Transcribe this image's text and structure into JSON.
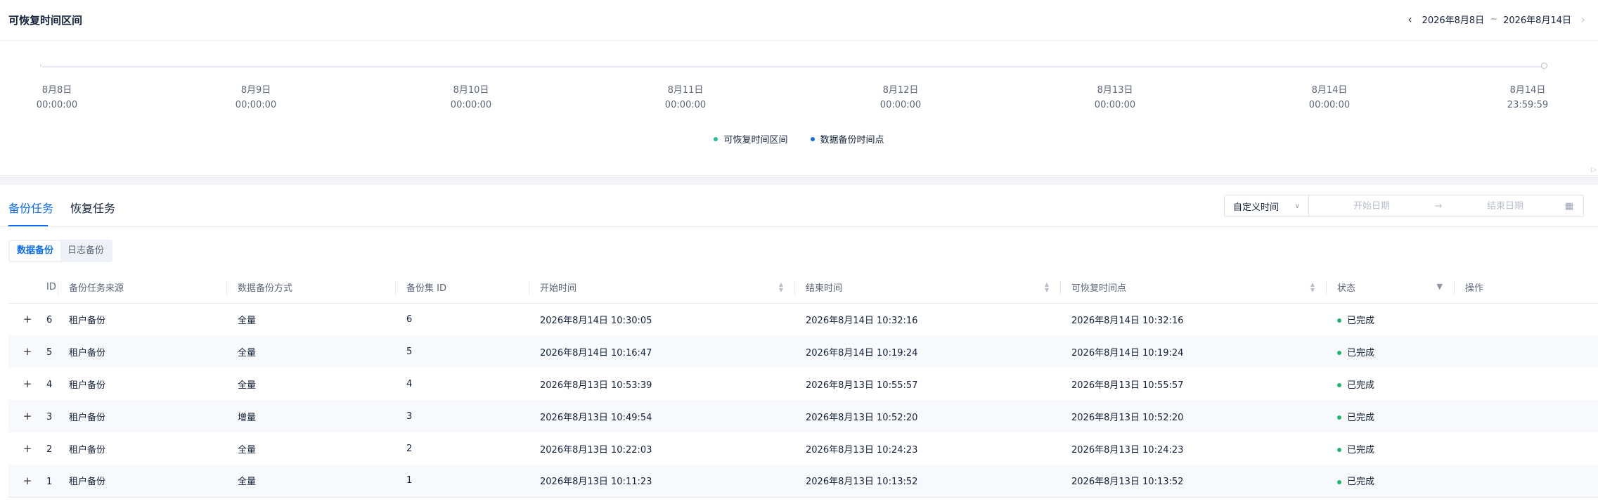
{
  "panel": {
    "title": "可恢复时间区间",
    "range_start": "2026年8月8日",
    "range_sep": "~",
    "range_end": "2026年8月14日"
  },
  "timeline": {
    "ticks": [
      {
        "date": "8月8日",
        "time": "00:00:00"
      },
      {
        "date": "8月9日",
        "time": "00:00:00"
      },
      {
        "date": "8月10日",
        "time": "00:00:00"
      },
      {
        "date": "8月11日",
        "time": "00:00:00"
      },
      {
        "date": "8月12日",
        "time": "00:00:00"
      },
      {
        "date": "8月13日",
        "time": "00:00:00"
      },
      {
        "date": "8月14日",
        "time": "00:00:00"
      },
      {
        "date": "8月14日",
        "time": "23:59:59"
      }
    ],
    "legend": [
      {
        "label": "可恢复时间区间",
        "color": "#1fbf9a"
      },
      {
        "label": "数据备份时间点",
        "color": "#1a6ee0"
      }
    ]
  },
  "tabs": [
    "备份任务",
    "恢复任务"
  ],
  "filter": {
    "select_value": "自定义时间",
    "start_placeholder": "开始日期",
    "end_placeholder": "结束日期"
  },
  "segment": [
    "数据备份",
    "日志备份"
  ],
  "table": {
    "headers": [
      "ID",
      "备份任务来源",
      "数据备份方式",
      "备份集 ID",
      "开始时间",
      "结束时间",
      "可恢复时间点",
      "状态",
      "操作"
    ],
    "status_color": "#1fb86a",
    "rows": [
      {
        "id": "6",
        "source": "租户备份",
        "mode": "全量",
        "set_id": "6",
        "start": "2026年8月14日 10:30:05",
        "end": "2026年8月14日 10:32:16",
        "point": "2026年8月14日 10:32:16",
        "status": "已完成"
      },
      {
        "id": "5",
        "source": "租户备份",
        "mode": "全量",
        "set_id": "5",
        "start": "2026年8月14日 10:16:47",
        "end": "2026年8月14日 10:19:24",
        "point": "2026年8月14日 10:19:24",
        "status": "已完成"
      },
      {
        "id": "4",
        "source": "租户备份",
        "mode": "全量",
        "set_id": "4",
        "start": "2026年8月13日 10:53:39",
        "end": "2026年8月13日 10:55:57",
        "point": "2026年8月13日 10:55:57",
        "status": "已完成"
      },
      {
        "id": "3",
        "source": "租户备份",
        "mode": "增量",
        "set_id": "3",
        "start": "2026年8月13日 10:49:54",
        "end": "2026年8月13日 10:52:20",
        "point": "2026年8月13日 10:52:20",
        "status": "已完成"
      },
      {
        "id": "2",
        "source": "租户备份",
        "mode": "全量",
        "set_id": "2",
        "start": "2026年8月13日 10:22:03",
        "end": "2026年8月13日 10:24:23",
        "point": "2026年8月13日 10:24:23",
        "status": "已完成"
      },
      {
        "id": "1",
        "source": "租户备份",
        "mode": "全量",
        "set_id": "1",
        "start": "2026年8月13日 10:11:23",
        "end": "2026年8月13日 10:13:52",
        "point": "2026年8月13日 10:13:52",
        "status": "已完成"
      }
    ]
  }
}
